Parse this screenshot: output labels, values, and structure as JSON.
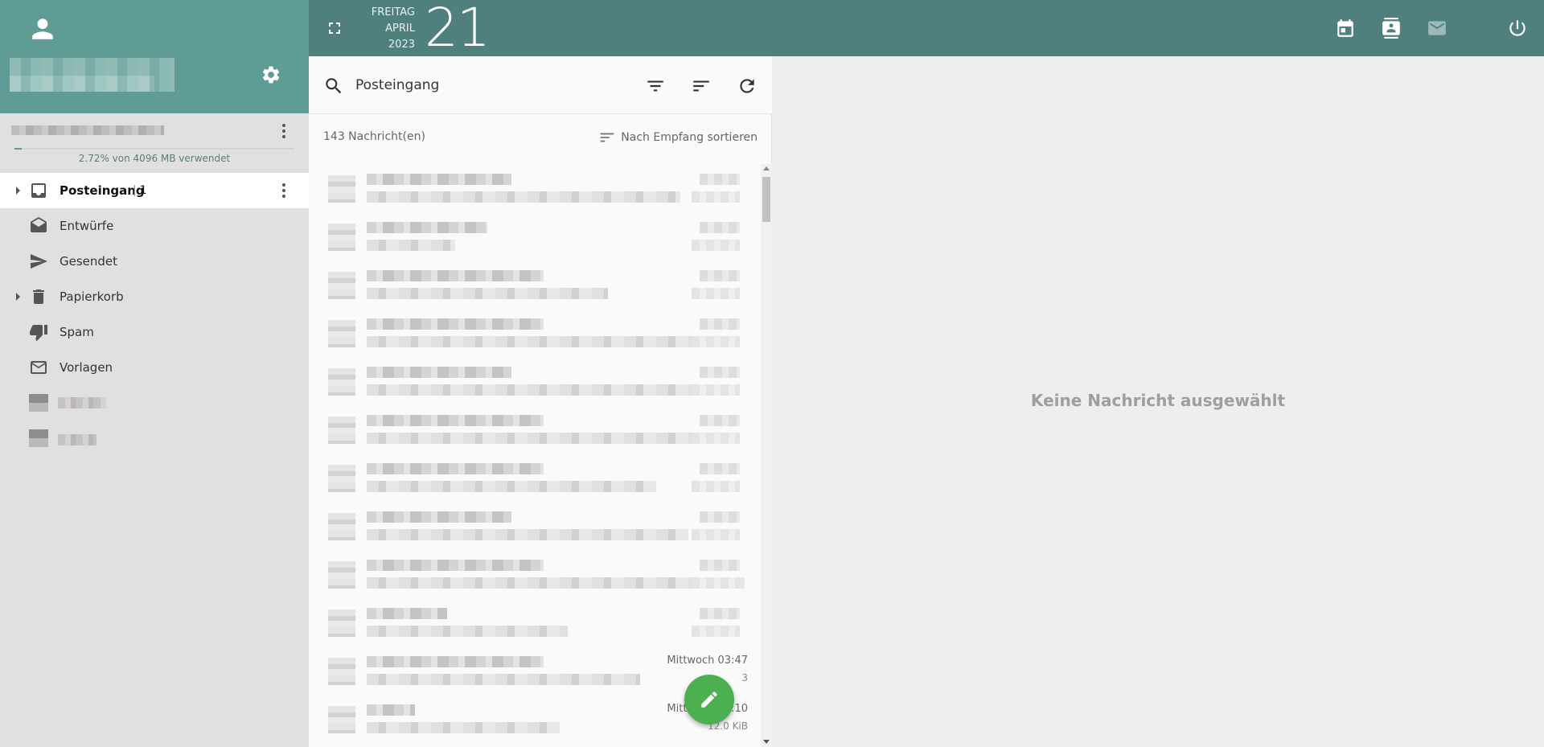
{
  "topbar": {
    "weekday": "FREITAG",
    "month": "APRIL",
    "year": "2023",
    "day": "21",
    "colors": {
      "bar": "#4f807e",
      "sidebar_head": "#5f9c95"
    }
  },
  "sidebar": {
    "quota": {
      "text": "2.72% von 4096 MB verwendet",
      "percent": 2.72
    },
    "folders": [
      {
        "label": "Posteingang",
        "count": "1",
        "icon": "inbox-icon",
        "active": true,
        "expandable": true
      },
      {
        "label": "Entwürfe",
        "icon": "drafts-icon"
      },
      {
        "label": "Gesendet",
        "icon": "send-icon"
      },
      {
        "label": "Papierkorb",
        "icon": "trash-icon",
        "expandable": true
      },
      {
        "label": "Spam",
        "icon": "thumb-down-icon"
      },
      {
        "label": "Vorlagen",
        "icon": "mail-outline-icon"
      }
    ]
  },
  "list": {
    "search_value": "Posteingang",
    "count_text": "143 Nachricht(en)",
    "sort_label": "Nach Empfang sortieren",
    "visible_row_dates": [
      {
        "row": 11,
        "date": "Mittwoch 03:47",
        "size": "3"
      },
      {
        "row": 12,
        "date": "Mittwoch 02:10",
        "size": "12.0 KiB"
      }
    ]
  },
  "reader": {
    "empty_text": "Keine Nachricht ausgewählt"
  },
  "accent": {
    "fab": "#4caf50"
  }
}
